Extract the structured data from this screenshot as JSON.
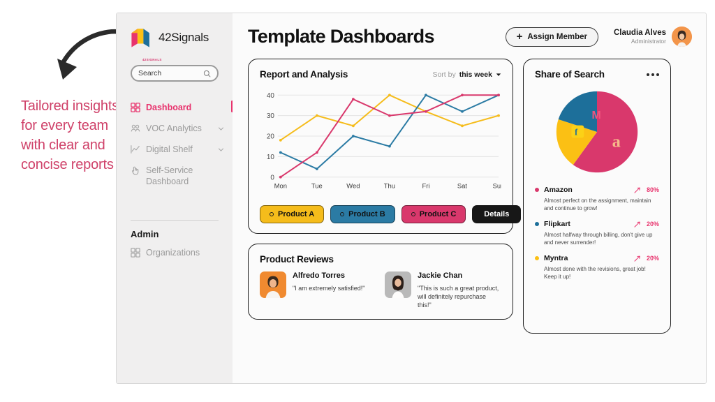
{
  "annotation": {
    "text": "Tailored insights for every team with clear and concise reports",
    "arrow_icon": "curved-arrow-icon",
    "color": "#cf4169"
  },
  "sidebar": {
    "brand": {
      "name": "42Signals",
      "logo_icon": "cube-logo-icon",
      "caption": "42SIGNALS"
    },
    "search": {
      "placeholder": "Search",
      "value": "Search",
      "icon": "search-icon"
    },
    "items": [
      {
        "label": "Dashboard",
        "icon": "grid-icon",
        "active": true,
        "chevron": false
      },
      {
        "label": "VOC Analytics",
        "icon": "people-icon",
        "active": false,
        "chevron": true
      },
      {
        "label": "Digital Shelf",
        "icon": "trend-chart-icon",
        "active": false,
        "chevron": true
      },
      {
        "label": "Self-Service Dashboard",
        "icon": "hand-click-icon",
        "active": false,
        "chevron": false
      }
    ],
    "admin_section": {
      "title": "Admin",
      "items": [
        {
          "label": "Organizations",
          "icon": "grid-icon"
        }
      ]
    }
  },
  "header": {
    "title": "Template Dashboards",
    "assign_button": {
      "label": "Assign Member",
      "icon": "plus-icon"
    },
    "user": {
      "name": "Claudia Alves",
      "role": "Administrator",
      "avatar": "user-avatar"
    }
  },
  "report_card": {
    "title": "Report and Analysis",
    "sort_label": "Sort by",
    "sort_value": "this week",
    "sort_caret": "caret-down-icon",
    "legend": [
      {
        "label": "Product A",
        "color": "#f5bc1b"
      },
      {
        "label": "Product B",
        "color": "#2b7ba4"
      },
      {
        "label": "Product C",
        "color": "#d9386c"
      }
    ],
    "details_button": "Details"
  },
  "chart_data": {
    "type": "line",
    "title": "Report and Analysis",
    "xlabel": "",
    "ylabel": "",
    "categories": [
      "Mon",
      "Tue",
      "Wed",
      "Thu",
      "Fri",
      "Sat",
      "Sun"
    ],
    "yticks": [
      0,
      10,
      20,
      30,
      40
    ],
    "ylim": [
      0,
      42
    ],
    "grid": true,
    "legend_position": "bottom",
    "series": [
      {
        "name": "Product A",
        "color": "#f5bc1b",
        "values": [
          18,
          30,
          25,
          40,
          32,
          25,
          30
        ]
      },
      {
        "name": "Product B",
        "color": "#2b7ba4",
        "values": [
          12,
          4,
          20,
          15,
          40,
          32,
          40
        ]
      },
      {
        "name": "Product C",
        "color": "#d9386c",
        "values": [
          0,
          12,
          38,
          30,
          32,
          40,
          40
        ]
      }
    ]
  },
  "reviews_card": {
    "title": "Product Reviews",
    "reviews": [
      {
        "name": "Alfredo Torres",
        "quote": "\"I am extremely satisfied!\"",
        "avatar": "reviewer-photo-male"
      },
      {
        "name": "Jackie Chan",
        "quote": "\"This is such a great product, will definitely repurchase this!\"",
        "avatar": "reviewer-photo-female"
      }
    ]
  },
  "share_of_search": {
    "title": "Share of Search",
    "menu_icon": "more-options-icon",
    "pie": {
      "type": "pie",
      "slices": [
        {
          "name": "Amazon",
          "value": 60,
          "color": "#d9386c",
          "brand_icon": "amazon-logo-icon"
        },
        {
          "name": "Myntra",
          "value": 20,
          "color": "#fbc014",
          "brand_icon": "myntra-logo-icon"
        },
        {
          "name": "Flipkart",
          "value": 20,
          "color": "#1d6f9a",
          "brand_icon": "flipkart-logo-icon"
        }
      ]
    },
    "items": [
      {
        "name": "Amazon",
        "pct": "80%",
        "color": "#d9386c",
        "trend_icon": "trend-up-icon",
        "desc": "Almost perfect on the assignment, maintain and continue to grow!"
      },
      {
        "name": "Flipkart",
        "pct": "20%",
        "color": "#1d6f9a",
        "trend_icon": "trend-up-icon",
        "desc": "Almost halfway through billing, don't give up and never surrender!"
      },
      {
        "name": "Myntra",
        "pct": "20%",
        "color": "#fbc014",
        "trend_icon": "trend-up-icon",
        "desc": "Almost done with the revisions, great job! Keep it up!"
      }
    ]
  }
}
